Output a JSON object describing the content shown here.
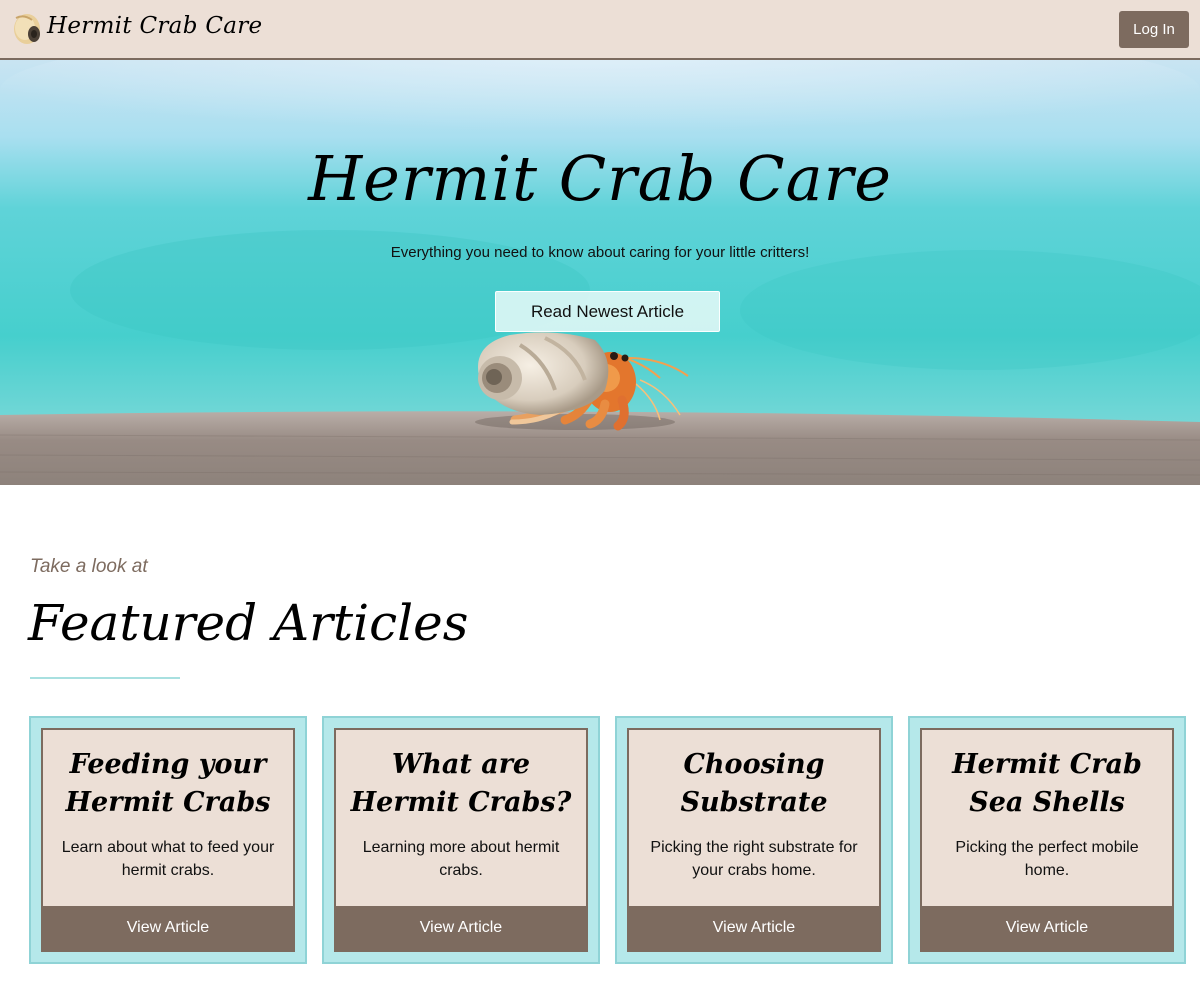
{
  "navbar": {
    "brand_name": "Hermit Crab Care",
    "logo_icon": "seashell-icon",
    "login_label": "Log In",
    "background_color": "#ecdfd6",
    "button_color": "#7d6b5f"
  },
  "hero": {
    "title": "Hermit Crab Care",
    "subtitle": "Everything you need to know about caring for your little critters!",
    "cta_label": "Read Newest Article",
    "image": "hermit-crab-on-beach-image"
  },
  "featured": {
    "eyebrow": "Take a look at",
    "title": "Featured Articles",
    "accent_color": "#b5e8ea",
    "cards": [
      {
        "title": "Feeding your Hermit Crabs",
        "description": "Learn about what to feed your hermit crabs.",
        "button_label": "View Article"
      },
      {
        "title": "What are Hermit Crabs?",
        "description": "Learning more about hermit crabs.",
        "button_label": "View Article"
      },
      {
        "title": "Choosing Substrate",
        "description": "Picking the right substrate for your crabs home.",
        "button_label": "View Article"
      },
      {
        "title": "Hermit Crab Sea Shells",
        "description": "Picking the perfect mobile home.",
        "button_label": "View Article"
      }
    ]
  }
}
